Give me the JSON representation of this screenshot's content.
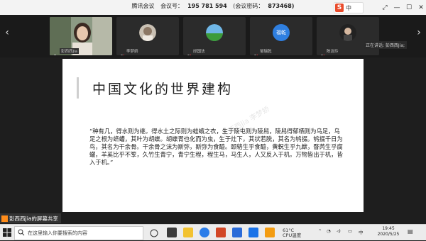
{
  "titlebar": {
    "app": "腾讯会议",
    "meeting_id_label": "会议号：",
    "meeting_id": "195 781 594",
    "password_label": "(会议密码：",
    "password": "873468)",
    "ime_label": "中"
  },
  "participants": [
    {
      "name": "彭西西Jia",
      "role": "presenter"
    },
    {
      "name": "李梦娇"
    },
    {
      "name": "邱国法"
    },
    {
      "name": "邹瑞乾"
    },
    {
      "name": "陈洁玲"
    }
  ],
  "avatar_text": {
    "p3": "福乾"
  },
  "speaker_label": "正在讲话: 彭西西Jia;",
  "slide": {
    "title": "中国文化的世界建构",
    "body": "“种有几，得水则为继。得水土之际则为蛙蠙之衣，生于陵屯则为陵舄，陵舄得郁栖则为乌足，乌足之根为蛴螬，其叶为胡蝶。胡蝶胥也化而为虫，生于灶下，其状若脱，其名为鸲掇。鸲掇千日为鸟，其名为干余骨。干余骨之沫为斯弥，斯弥为食醯。颐辂生乎食醯，黄軦生乎九猷，瞀芮生乎腐蠸，羊奚比乎不箰，久竹生青宁，青宁生程，程生马，马生人，人又反入于机。万物皆出于机，皆入于机。”",
    "watermark": "彭西西Jia 李梦娇"
  },
  "share_bar": {
    "text": "彭西西Jia的屏幕共享"
  },
  "taskbar": {
    "search_placeholder": "在这里输入你要搜索的内容",
    "weather": "61°C",
    "weather_sub": "CPU温度",
    "ime": "中",
    "time": "19:45",
    "date": "2020/5/25"
  }
}
